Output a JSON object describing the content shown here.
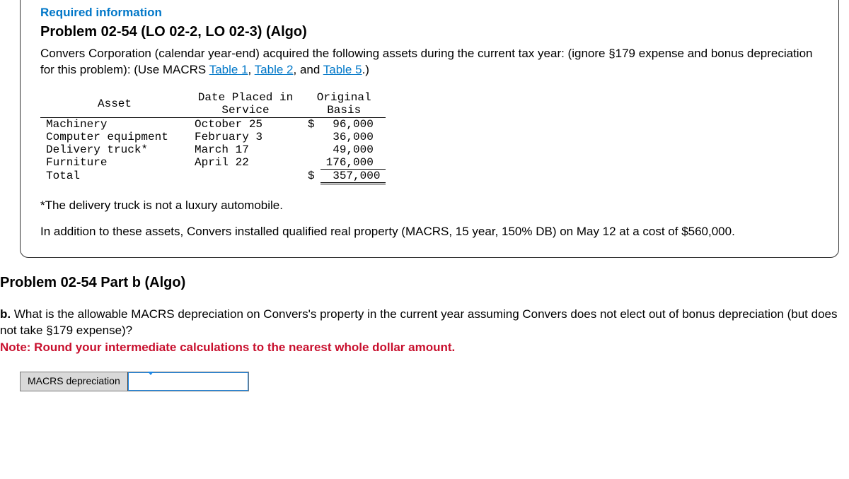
{
  "card": {
    "required": "Required information",
    "title": "Problem 02-54 (LO 02-2, LO 02-3) (Algo)",
    "desc_pre": "Convers Corporation (calendar year-end) acquired the following assets during the current tax year: (ignore §179 expense and bonus depreciation for this problem): (Use MACRS ",
    "link1": "Table 1",
    "sep1": ", ",
    "link2": "Table 2",
    "sep2": ", and ",
    "link3": "Table 5",
    "desc_post": ".)",
    "table": {
      "h_asset": "Asset",
      "h_date": "Date Placed in\nService",
      "h_basis": "Original\nBasis",
      "rows": [
        {
          "asset": "Machinery",
          "date": "October 25",
          "cur": "$",
          "basis": " 96,000"
        },
        {
          "asset": "Computer equipment",
          "date": "February 3",
          "cur": "",
          "basis": " 36,000"
        },
        {
          "asset": "Delivery truck*",
          "date": "March 17",
          "cur": "",
          "basis": " 49,000"
        },
        {
          "asset": "Furniture",
          "date": "April 22",
          "cur": "",
          "basis": "176,000"
        }
      ],
      "total_label": "Total",
      "total_cur": "$",
      "total_val": " 357,000"
    },
    "footnote": "*The delivery truck is not a luxury automobile.",
    "addl": "In addition to these assets, Convers installed qualified real property (MACRS, 15 year, 150% DB) on May 12 at a cost of $560,000."
  },
  "part": {
    "title": "Problem 02-54 Part b (Algo)",
    "q_prefix": "b. ",
    "q_text": "What is the allowable MACRS depreciation on Convers's property in the current year assuming Convers does not elect out of bonus depreciation (but does not take §179 expense)?",
    "note": "Note: Round your intermediate calculations to the nearest whole dollar amount.",
    "answer_label": "MACRS depreciation"
  }
}
